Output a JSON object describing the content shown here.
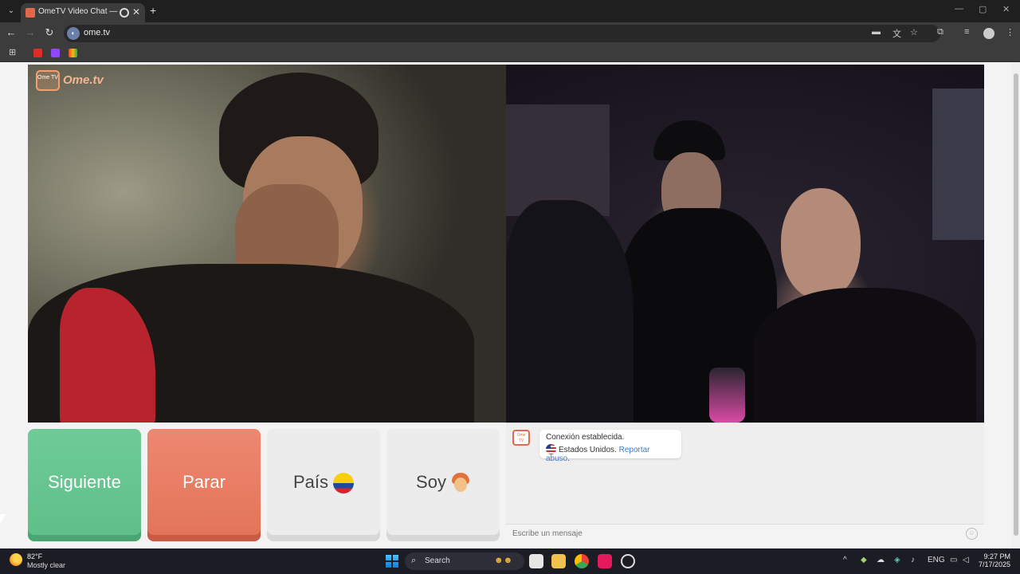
{
  "browser": {
    "tab_title": "OmeTV Video Chat — Ome",
    "tab_close": "✕",
    "new_tab": "+",
    "url": "ome.tv",
    "window_controls": [
      "—",
      "▢",
      "✕"
    ]
  },
  "logo": {
    "box": "Ome TV",
    "text": "Ome.tv"
  },
  "controls": {
    "next_label": "Siguiente",
    "stop_label": "Parar",
    "country_label": "País",
    "me_label": "Soy"
  },
  "chat": {
    "logo_text": "Ome TV",
    "connection": "Conexión establecida.",
    "country": "Estados Unidos.",
    "report": "Reportar abuso",
    "report_suffix": ".",
    "input_placeholder": "Escribe un mensaje"
  },
  "taskbar": {
    "temperature": "82°F",
    "weather": "Mostly clear",
    "search_label": "Search",
    "language": "ENG",
    "time": "9:27 PM",
    "date": "7/17/2025"
  },
  "colors": {
    "next": "#6ecb98",
    "stop": "#e27458",
    "neutral": "#ececec",
    "link": "#3a7bd5"
  },
  "icons": [
    "tab-list-icon",
    "record-icon",
    "back-icon",
    "forward-icon",
    "reload-icon",
    "site-icon",
    "translate-icon",
    "bookmark-star-icon",
    "extensions-icon",
    "profile-icon",
    "menu-icon",
    "apps-grid-icon",
    "youtube-icon",
    "twitch-icon",
    "gmail-icon",
    "colombia-flag-icon",
    "boy-avatar-icon",
    "usa-flag-icon",
    "smile-icon",
    "weather-icon",
    "windows-start-icon",
    "search-icon"
  ]
}
